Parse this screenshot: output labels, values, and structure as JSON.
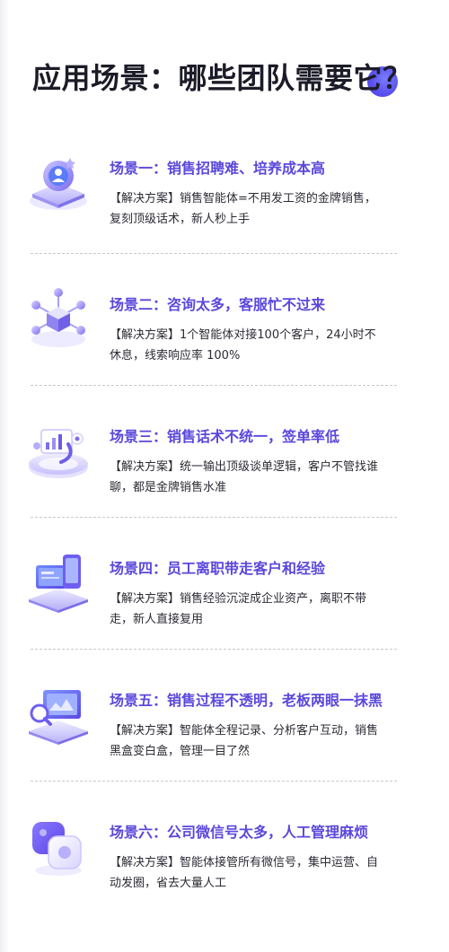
{
  "title": "应用场景：哪些团队需要它？",
  "scenes": [
    {
      "title": "场景一：销售招聘难、培养成本高",
      "desc": "【解决方案】销售智能体=不用发工资的金牌销售，复刻顶级话术，新人秒上手",
      "icon": "user-badge-platform-icon"
    },
    {
      "title": "场景二：咨询太多，客服忙不过来",
      "desc": "【解决方案】1个智能体对接100个客户，24小时不休息，线索响应率 100%",
      "icon": "network-cube-icon"
    },
    {
      "title": "场景三：销售话术不统一，签单率低",
      "desc": "【解决方案】统一输出顶级谈单逻辑，客户不管找谁聊，都是金牌销售水准",
      "icon": "analytics-platform-icon"
    },
    {
      "title": "场景四：员工离职带走客户和经验",
      "desc": "【解决方案】销售经验沉淀成企业资产，离职不带走，新人直接复用",
      "icon": "laptop-phone-icon"
    },
    {
      "title": "场景五：销售过程不透明，老板两眼一抹黑",
      "desc": "【解决方案】智能体全程记录、分析客户互动，销售黑盒变白盒，管理一目了然",
      "icon": "monitor-magnifier-icon"
    },
    {
      "title": "场景六：公司微信号太多，人工管理麻烦",
      "desc": "【解决方案】智能体接管所有微信号，集中运营、自动发圈，省去大量人工",
      "icon": "stacked-squares-icon"
    }
  ]
}
